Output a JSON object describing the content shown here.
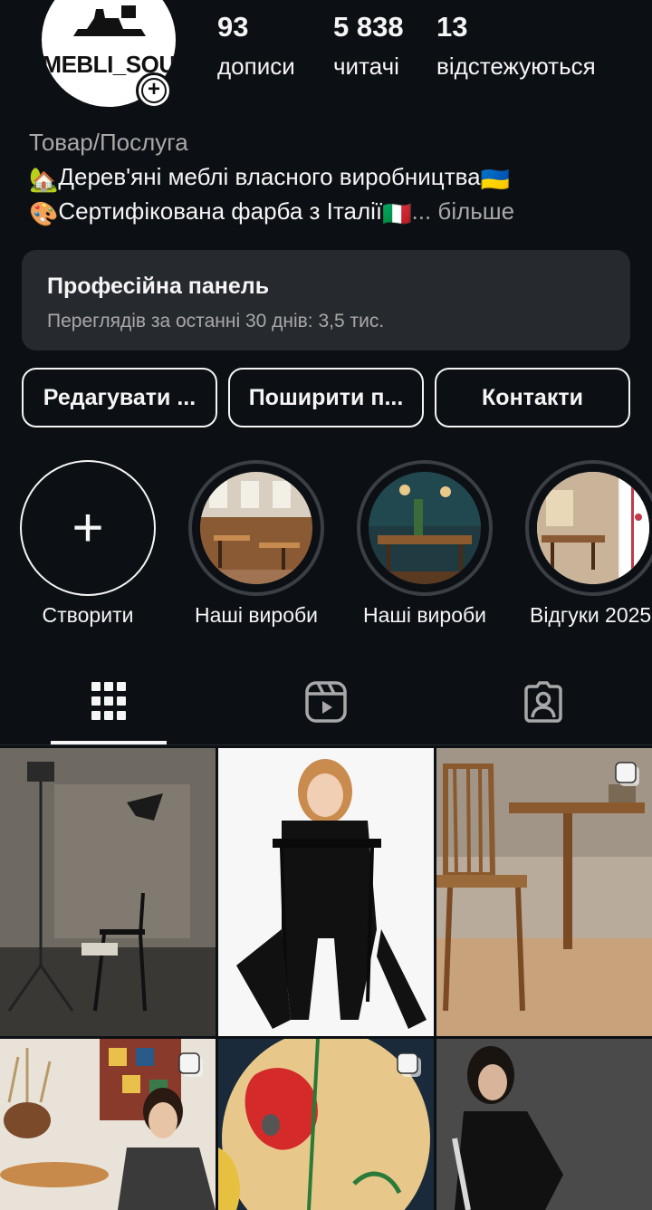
{
  "profile": {
    "avatar_text": "MEBLI_SOU",
    "stats": [
      {
        "num": "93",
        "label": "дописи"
      },
      {
        "num": "5 838",
        "label": "читачі"
      },
      {
        "num": "13",
        "label": "відстежуються"
      }
    ],
    "category": "Товар/Послуга",
    "bio_line1_emoji": "🏡",
    "bio_line1": "Дерев'яні меблі власного виробництва",
    "bio_line1_flag": "🇺🇦",
    "bio_line2_emoji": "🎨",
    "bio_line2": "Сертифікована фарба з Італії",
    "bio_line2_flag": "🇮🇹",
    "bio_more": "... більше"
  },
  "pro_panel": {
    "title": "Професійна панель",
    "subtitle": "Переглядів за останні 30 днів: 3,5 тис."
  },
  "buttons": {
    "edit": "Редагувати ...",
    "share": "Поширити п...",
    "contacts": "Контакти"
  },
  "highlights": [
    {
      "label": "Створити",
      "icon": "plus-icon"
    },
    {
      "label": "Наші вироби"
    },
    {
      "label": "Наші вироби"
    },
    {
      "label": "Відгуки 2025"
    }
  ],
  "tabs": [
    {
      "name": "grid",
      "icon": "grid-icon",
      "active": true
    },
    {
      "name": "reels",
      "icon": "reels-icon",
      "active": false
    },
    {
      "name": "tagged",
      "icon": "tagged-icon",
      "active": false
    }
  ],
  "colors": {
    "background": "#0c1014",
    "panel": "#262a2f",
    "text": "#f5f5f5",
    "muted": "#a8a8a8"
  }
}
